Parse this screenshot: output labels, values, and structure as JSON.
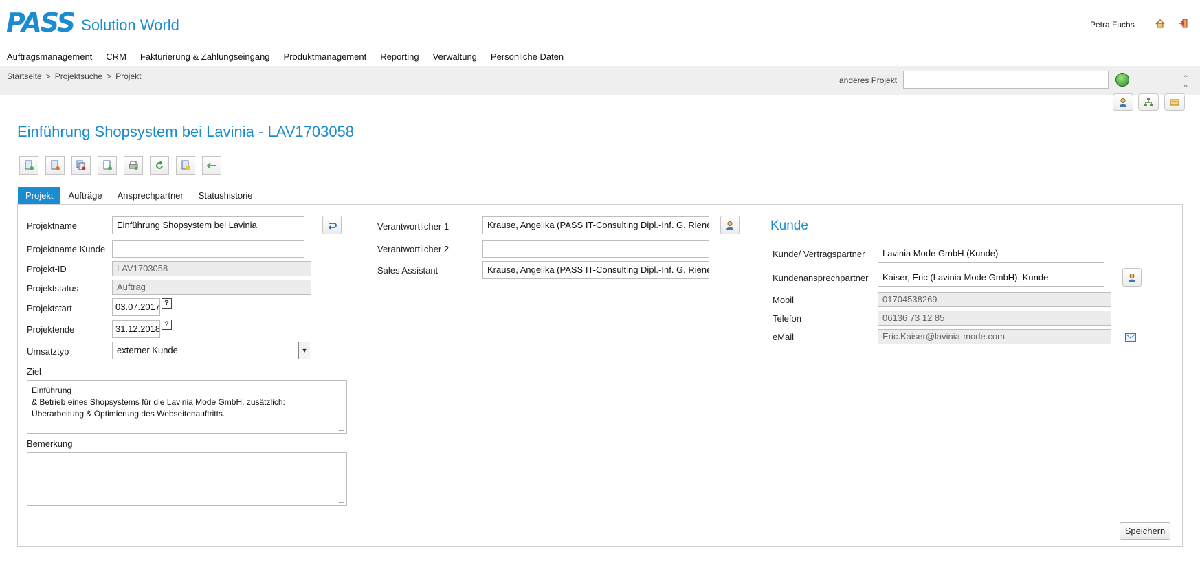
{
  "header": {
    "logo_mark": "PASS",
    "logo_text": "Solution World",
    "username": "Petra Fuchs",
    "icons": [
      "home-icon",
      "logout-icon"
    ]
  },
  "menu": {
    "items": [
      {
        "label": "Auftragsmanagement"
      },
      {
        "label": "CRM"
      },
      {
        "label": "Fakturierung & Zahlungseingang"
      },
      {
        "label": "Produktmanagement"
      },
      {
        "label": "Reporting"
      },
      {
        "label": "Verwaltung"
      },
      {
        "label": "Persönliche Daten"
      }
    ]
  },
  "breadcrumb": {
    "items": [
      "Startseite",
      "Projektsuche",
      "Projekt"
    ],
    "separator": ">"
  },
  "other_project": {
    "label": "anderes Projekt",
    "value": ""
  },
  "page": {
    "title": "Einführung Shopsystem bei Lavinia  -  LAV1703058"
  },
  "tabs": [
    {
      "label": "Projekt",
      "active": true
    },
    {
      "label": "Aufträge",
      "active": false
    },
    {
      "label": "Ansprechpartner",
      "active": false
    },
    {
      "label": "Statushistorie",
      "active": false
    }
  ],
  "projekt": {
    "projektname_label": "Projektname",
    "projektname_value": "Einführung Shopsystem bei Lavinia",
    "projektname_kunde_label": "Projektname Kunde",
    "projektname_kunde_value": "",
    "projekt_id_label": "Projekt-ID",
    "projekt_id_value": "LAV1703058",
    "projektstatus_label": "Projektstatus",
    "projektstatus_value": "Auftrag",
    "projektstart_label": "Projektstart",
    "projektstart_value": "03.07.2017",
    "projektende_label": "Projektende",
    "projektende_value": "31.12.2018",
    "help_glyph": "?",
    "umsatztyp_label": "Umsatztyp",
    "umsatztyp_value": "externer Kunde",
    "ziel_label": "Ziel",
    "ziel_value": "Einführung\n & Betrieb eines Shopsystems für die Lavinia Mode GmbH, zusätzlich:\nÜberarbeitung & Optimierung des Webseitenauftritts.",
    "bemerkung_label": "Bemerkung",
    "bemerkung_value": ""
  },
  "verantwortlich": {
    "v1_label": "Verantwortlicher 1",
    "v1_value": "Krause, Angelika (PASS IT-Consulting Dipl.-Inf. G. Rienecke",
    "v2_label": "Verantwortlicher 2",
    "v2_value": "",
    "sales_label": "Sales Assistant",
    "sales_value": "Krause, Angelika (PASS IT-Consulting Dipl.-Inf. G. Rienecke"
  },
  "kunde": {
    "title": "Kunde",
    "vertragspartner_label": "Kunde/ Vertragspartner",
    "vertragspartner_value": "Lavinia Mode GmbH (Kunde)",
    "ansprechpartner_label": "Kundenansprechpartner",
    "ansprechpartner_value": "Kaiser, Eric (Lavinia Mode GmbH), Kunde",
    "mobil_label": "Mobil",
    "mobil_value": "01704538269",
    "telefon_label": "Telefon",
    "telefon_value": "06136 73 12 85",
    "email_label": "eMail",
    "email_value": "Eric.Kaiser@lavinia-mode.com"
  },
  "actions": {
    "save_label": "Speichern"
  },
  "colors": {
    "accent": "#1a8ccf",
    "crumbbar": "#efefef",
    "readonly": "#ececec"
  }
}
